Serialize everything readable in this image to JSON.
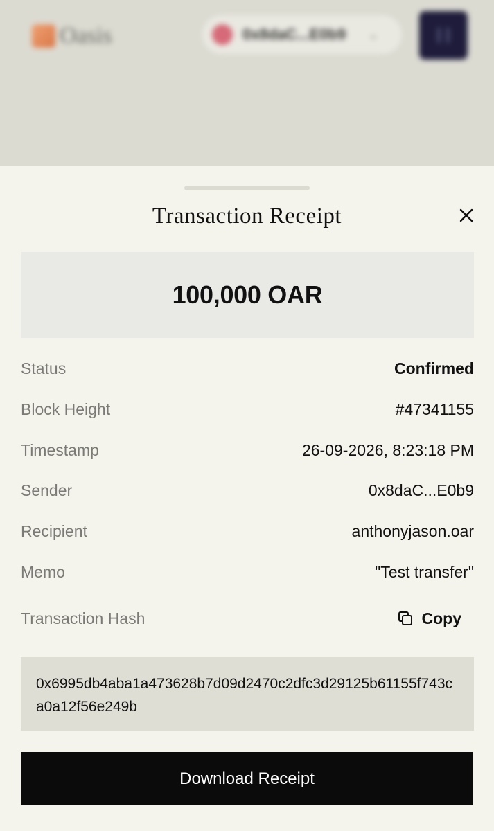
{
  "background": {
    "logo_text": "Oasis",
    "account_pill": "0x8daC...E0b9",
    "colors": {
      "menu_button": "#1e1c3a",
      "overlay": "#dcdbd2"
    }
  },
  "sheet": {
    "title": "Transaction Receipt",
    "close_icon": "close-icon",
    "amount": "100,000 OAR",
    "details": [
      {
        "label": "Status",
        "value": "Confirmed"
      },
      {
        "label": "Block Height",
        "value": "#47341155"
      },
      {
        "label": "Timestamp",
        "value": "26-09-2026, 8:23:18 PM"
      },
      {
        "label": "Sender",
        "value": "0x8daC...E0b9"
      },
      {
        "label": "Recipient",
        "value": "anthonyjason.oar"
      },
      {
        "label": "Memo",
        "value": "\"Test transfer\""
      }
    ],
    "hash_label": "Transaction Hash",
    "copy_label": "Copy",
    "copy_icon": "copy-icon",
    "hash_value": "0x6995db4aba1a473628b7d09d2470c2dfc3d29125b61155f743ca0a12f56e249b",
    "download_label": "Download Receipt",
    "colors": {
      "sheet_bg": "#f5f4ec",
      "amount_bg": "#e9e9e6",
      "hash_bg": "#dfded4",
      "button_bg": "#0b0b0b",
      "label_text": "#7a7a76"
    }
  }
}
